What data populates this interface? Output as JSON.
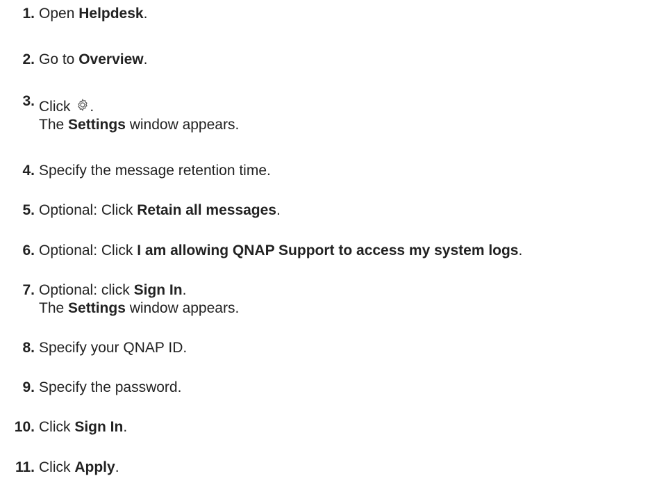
{
  "steps": [
    {
      "number": "1.",
      "parts": [
        "Open ",
        "Helpdesk",
        "."
      ]
    },
    {
      "number": "2.",
      "parts": [
        "Go to ",
        "Overview",
        "."
      ]
    },
    {
      "number": "3.",
      "line1_prefix": "Click ",
      "line1_suffix": ".",
      "icon": "gear-icon",
      "line2": [
        "The ",
        "Settings",
        " window appears."
      ]
    },
    {
      "number": "4.",
      "text": "Specify the message retention time."
    },
    {
      "number": "5.",
      "parts": [
        "Optional: Click ",
        "Retain all messages",
        "."
      ]
    },
    {
      "number": "6.",
      "parts": [
        "Optional: Click ",
        "I am allowing QNAP Support to access my system logs",
        "."
      ]
    },
    {
      "number": "7.",
      "line1": [
        "Optional: click ",
        "Sign In",
        "."
      ],
      "line2": [
        "The ",
        "Settings",
        " window appears."
      ]
    },
    {
      "number": "8.",
      "text": "Specify your QNAP ID."
    },
    {
      "number": "9.",
      "text": "Specify the password."
    },
    {
      "number": "10.",
      "parts": [
        "Click ",
        "Sign In",
        "."
      ]
    },
    {
      "number": "11.",
      "parts": [
        "Click ",
        "Apply",
        "."
      ]
    }
  ]
}
